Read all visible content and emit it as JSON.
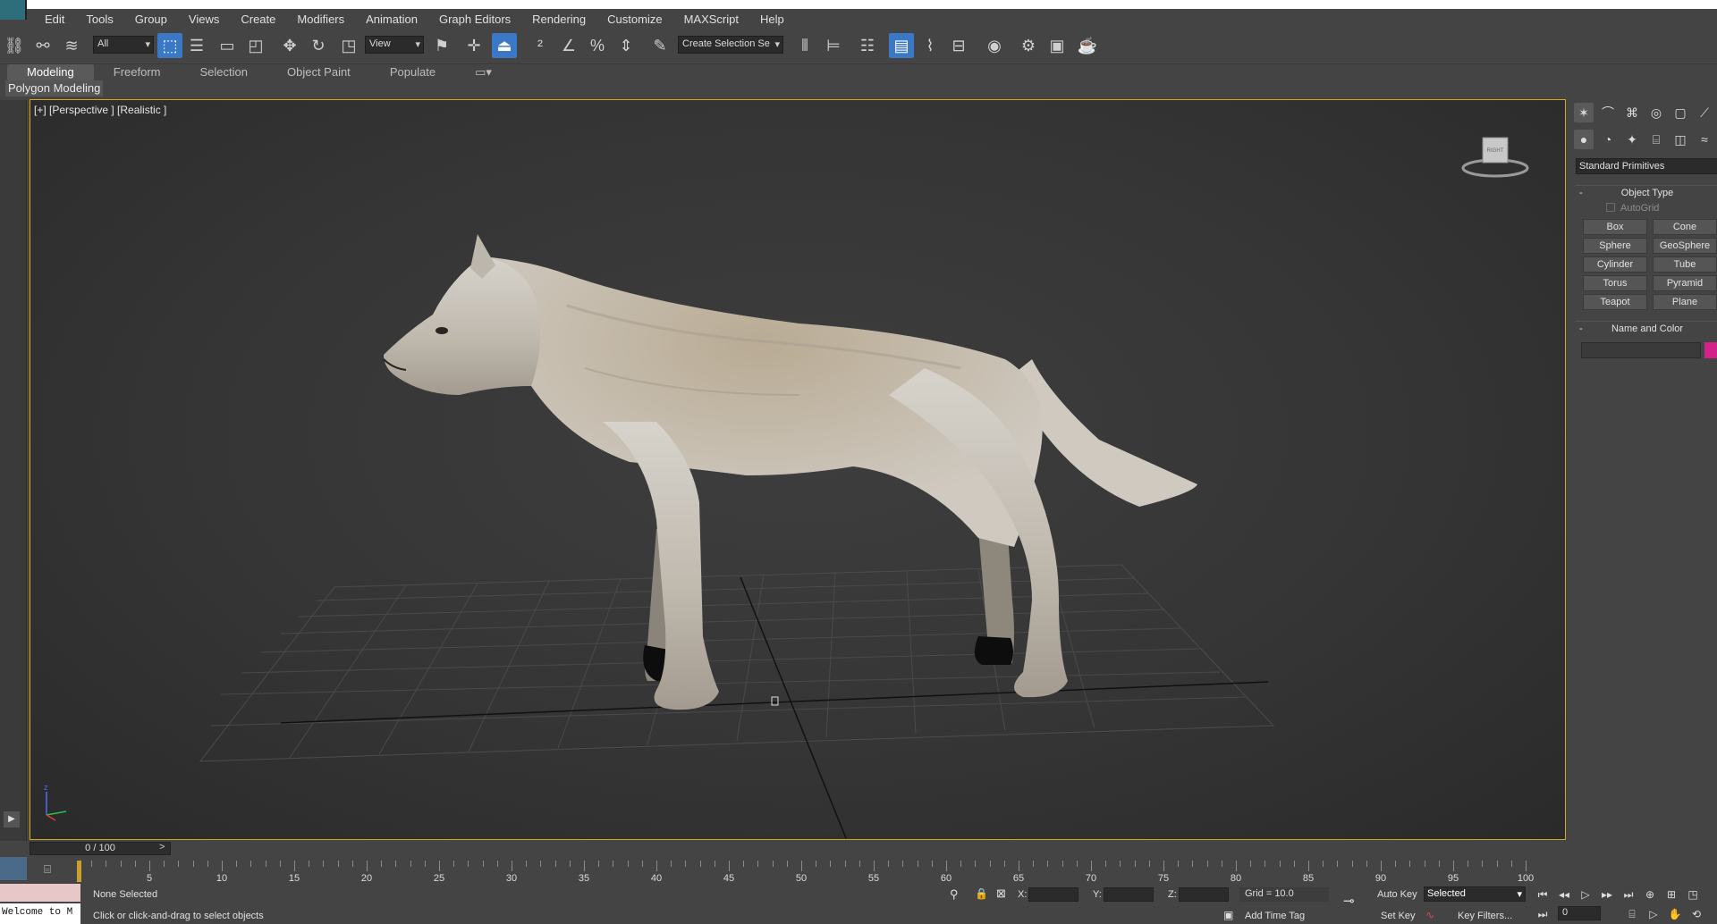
{
  "menu": [
    "Edit",
    "Tools",
    "Group",
    "Views",
    "Create",
    "Modifiers",
    "Animation",
    "Graph Editors",
    "Rendering",
    "Customize",
    "MAXScript",
    "Help"
  ],
  "toolbar": {
    "selection_filter": "All",
    "reference_coord": "View",
    "named_selection_placeholder": "Create Selection Se"
  },
  "ribbon": {
    "tabs": [
      "Modeling",
      "Freeform",
      "Selection",
      "Object Paint",
      "Populate"
    ],
    "selected_tab": "Modeling",
    "sub_label": "Polygon Modeling"
  },
  "viewport": {
    "label": "[+] [Perspective ] [Realistic ]",
    "axis_z": "z",
    "viewcube_label": "RIGHT"
  },
  "command_panel": {
    "category": "Standard Primitives",
    "object_type_title": "Object Type",
    "autogrid_label": "AutoGrid",
    "buttons": [
      "Box",
      "Cone",
      "Sphere",
      "GeoSphere",
      "Cylinder",
      "Tube",
      "Torus",
      "Pyramid",
      "Teapot",
      "Plane"
    ],
    "name_color_title": "Name and Color",
    "object_color": "#d3228a"
  },
  "timeline": {
    "frame_display": "0 / 100",
    "ticks": [
      "5",
      "10",
      "15",
      "20",
      "25",
      "30",
      "35",
      "40",
      "45",
      "50",
      "55",
      "60",
      "65",
      "70",
      "75",
      "80",
      "85",
      "90",
      "95",
      "100"
    ]
  },
  "status": {
    "maxscript_text": "Welcome to M",
    "selection_status": "None Selected",
    "prompt": "Click or click-and-drag to select objects",
    "x_label": "X:",
    "y_label": "Y:",
    "z_label": "Z:",
    "grid": "Grid = 10.0",
    "add_time_tag": "Add Time Tag",
    "auto_key": "Auto Key",
    "set_key": "Set Key",
    "auto_key_mode": "Selected",
    "key_filters": "Key Filters...",
    "current_frame": "0"
  },
  "colors": {
    "viewport_border": "#d4a71e",
    "active_blue": "#3b78c5"
  }
}
